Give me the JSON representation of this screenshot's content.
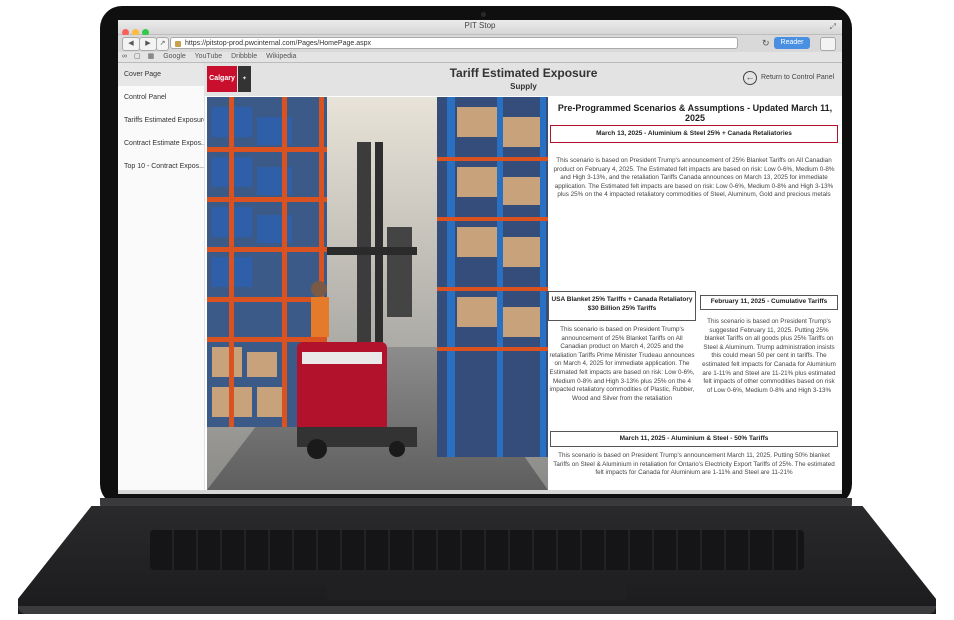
{
  "browser": {
    "window_title": "PIT Stop",
    "url": "https://pitstop-prod.pwcinternal.com/Pages/HomePage.aspx",
    "reader_label": "Reader",
    "bookmarks": [
      "Google",
      "YouTube",
      "Dribbble",
      "Wikipedia"
    ]
  },
  "sidebar": {
    "items": [
      {
        "label": "Cover Page"
      },
      {
        "label": "Control Panel"
      },
      {
        "label": "Tariffs Estimated Exposure"
      },
      {
        "label": "Contract Estimate Expos..."
      },
      {
        "label": "Top 10 - Contract Expos..."
      }
    ]
  },
  "header": {
    "logo_text": "Calgary",
    "title": "Tariff Estimated Exposure",
    "subtitle": "Supply",
    "return_label": "Return to Control Panel"
  },
  "main": {
    "section_title": "Pre-Programmed Scenarios & Assumptions - Updated March 11, 2025",
    "scenarios": [
      {
        "heading": "March 13, 2025 - Aluminium & Steel 25% + Canada Retaliatories",
        "text": "This scenario is based on President Trump's announcement of 25% Blanket Tariffs on All Canadian product on February 4, 2025. The Estimated felt impacts are based on risk: Low 0-6%, Medium 0-8% and High 3-13%, and the retaliation Tariffs Canada announces on March 13, 2025 for immediate application. The Estimated felt impacts are based on risk: Low 0-6%, Medium 0-8% and High 3-13% plus 25% on the 4 impacted retaliatory commodities of Steel, Aluminum, Gold and precious metals"
      },
      {
        "heading": "USA Blanket 25% Tariffs + Canada Retaliatory $30 Billion 25% Tariffs",
        "text": "This scenario is based on President Trump's announcement of 25% Blanket Tariffs on All Canadian product on March 4, 2025 and the retaliation Tariffs Prime Minister Trudeau announces on March 4, 2025 for immediate application. The Estimated felt impacts are based on risk: Low 0-6%, Medium 0-8% and High 3-13% plus 25% on the 4 impacted retaliatory commodities of Plastic, Rubber, Wood and Silver from the retaliation"
      },
      {
        "heading": "February 11, 2025 - Cumulative Tariffs",
        "text": "This scenario is based on President Trump's suggested February 11, 2025. Putting 25% blanket Tariffs on all goods plus 25% Tariffs on Steel & Aluminum. Trump administration insists this could mean 50 per cent in tariffs. The estimated felt impacts for Canada for Aluminium are 1-11% and Steel are 11-21% plus estimated felt impacts of other commodities based on risk of Low 0-6%, Medium 0-8% and High 3-13%"
      },
      {
        "heading": "March 11, 2025 - Aluminium & Steel - 50% Tariffs",
        "text": "This scenario is based on President Trump's announcement March 11, 2025. Putting 50% blanket Tariffs on Steel & Aluminium in retaliation for Ontario's Electricity Export Tariffs of 25%. The estimated felt impacts for Canada for Aluminium are 1-11% and Steel are 11-21%"
      }
    ]
  },
  "colors": {
    "accent": "#c8102e",
    "header_bg": "#e3e3e3",
    "reader_button": "#4a90e2"
  }
}
